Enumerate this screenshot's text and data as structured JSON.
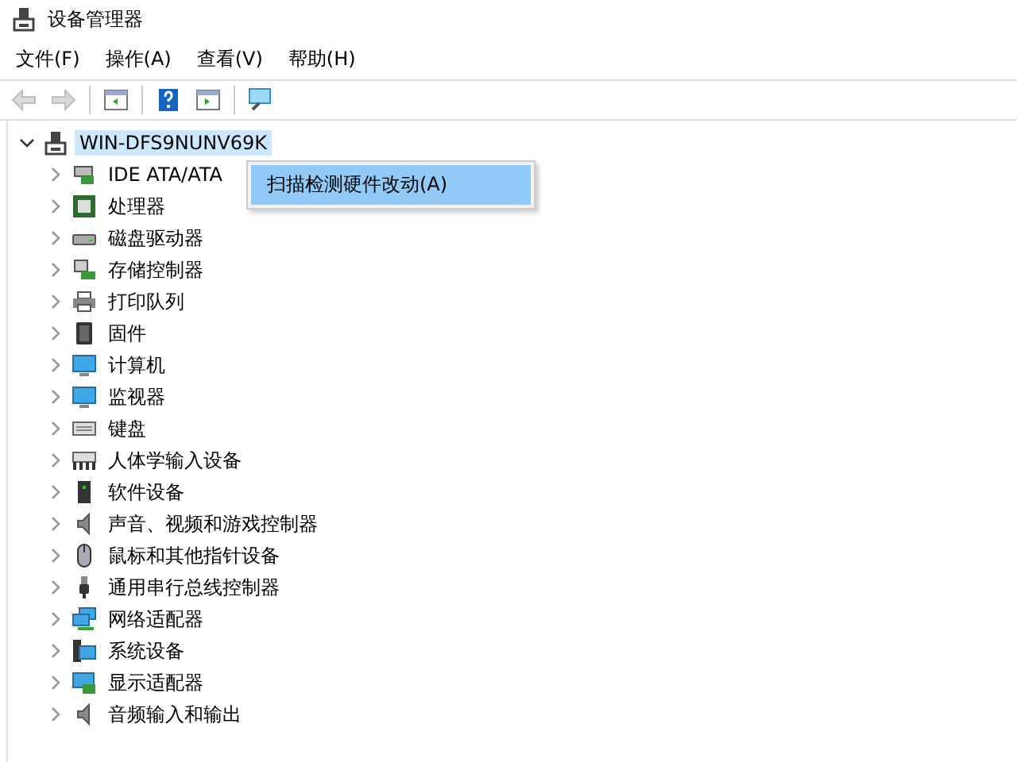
{
  "window": {
    "title": "设备管理器"
  },
  "menu_bar": [
    {
      "label": "文件(F)"
    },
    {
      "label": "操作(A)"
    },
    {
      "label": "查看(V)"
    },
    {
      "label": "帮助(H)"
    }
  ],
  "toolbar": [
    {
      "kind": "back",
      "disabled": true
    },
    {
      "kind": "forward",
      "disabled": true
    },
    {
      "kind": "separator"
    },
    {
      "kind": "tree",
      "disabled": false
    },
    {
      "kind": "separator"
    },
    {
      "kind": "help",
      "disabled": false
    },
    {
      "kind": "pane",
      "disabled": false
    },
    {
      "kind": "separator"
    },
    {
      "kind": "scan",
      "disabled": false
    }
  ],
  "tree": {
    "label": "WIN-DFS9NUNV69K",
    "expanded": true,
    "selected": true,
    "children": [
      {
        "label": "IDE ATA/ATA",
        "expanded": false,
        "selected": false
      },
      {
        "label": "处理器",
        "expanded": false,
        "selected": false
      },
      {
        "label": "磁盘驱动器",
        "expanded": false,
        "selected": false
      },
      {
        "label": "存储控制器",
        "expanded": false,
        "selected": false
      },
      {
        "label": "打印队列",
        "expanded": false,
        "selected": false
      },
      {
        "label": "固件",
        "expanded": false,
        "selected": false
      },
      {
        "label": "计算机",
        "expanded": false,
        "selected": false
      },
      {
        "label": "监视器",
        "expanded": false,
        "selected": false
      },
      {
        "label": "键盘",
        "expanded": false,
        "selected": false
      },
      {
        "label": "人体学输入设备",
        "expanded": false,
        "selected": false
      },
      {
        "label": "软件设备",
        "expanded": false,
        "selected": false
      },
      {
        "label": "声音、视频和游戏控制器",
        "expanded": false,
        "selected": false
      },
      {
        "label": "鼠标和其他指针设备",
        "expanded": false,
        "selected": false
      },
      {
        "label": "通用串行总线控制器",
        "expanded": false,
        "selected": false
      },
      {
        "label": "网络适配器",
        "expanded": false,
        "selected": false
      },
      {
        "label": "系统设备",
        "expanded": false,
        "selected": false
      },
      {
        "label": "显示适配器",
        "expanded": false,
        "selected": false
      },
      {
        "label": "音频输入和输出",
        "expanded": false,
        "selected": false
      }
    ]
  },
  "context_menu": [
    {
      "label": "扫描检测硬件改动(A)",
      "selected": true
    }
  ]
}
